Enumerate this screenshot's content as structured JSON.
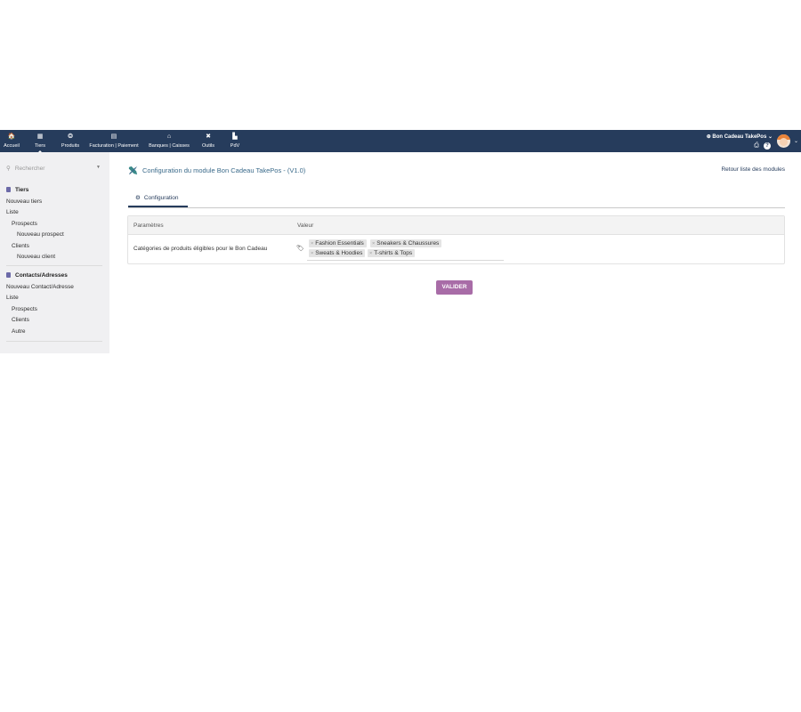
{
  "nav": {
    "items": [
      {
        "label": "Accueil",
        "icon": "home-icon",
        "glyph": "🏠"
      },
      {
        "label": "Tiers",
        "icon": "building-icon",
        "glyph": "▦",
        "active": true
      },
      {
        "label": "Produits",
        "icon": "cube-icon",
        "glyph": "❂"
      },
      {
        "label": "Facturation | Paiement",
        "icon": "file-icon",
        "glyph": "▤"
      },
      {
        "label": "Banques | Caisses",
        "icon": "bank-icon",
        "glyph": "⌂"
      },
      {
        "label": "Outils",
        "icon": "tools-icon",
        "glyph": "✖"
      },
      {
        "label": "PdV",
        "icon": "cash-register-icon",
        "glyph": "▙"
      }
    ],
    "company": "Bon Cadeau TakePos",
    "company_caret": "⌄",
    "globe_glyph": "⊕",
    "print_glyph": "⎙",
    "help_glyph": "?"
  },
  "sidebar": {
    "search_placeholder": "Rechercher",
    "search_icon": "⚲",
    "search_caret": "▼",
    "tiers_title": "Tiers",
    "tiers_links": [
      "Nouveau tiers",
      "Liste",
      "Prospects",
      "Nouveau prospect",
      "Clients",
      "Nouveau client"
    ],
    "contacts_title": "Contacts/Adresses",
    "contacts_links": [
      "Nouveau Contact/Adresse",
      "Liste",
      "Prospects",
      "Clients",
      "Autre"
    ],
    "tiers_color": "#6c6aa8",
    "contacts_color": "#6c6aa8"
  },
  "page": {
    "title": "Configuration du module Bon Cadeau TakePos - (V1.0)",
    "back_link": "Retour liste des modules",
    "tab_label": "Configuration",
    "tab_icon_glyph": "⚙"
  },
  "table": {
    "col_params": "Paramètres",
    "col_value": "Valeur",
    "row_label": "Catégories de produits éligibles pour le Bon Cadeau",
    "tag_glyph": "🏷",
    "chips": [
      "Fashion Essentials",
      "Sneakers & Chaussures",
      "Sweats & Hoodies",
      "T-shirts & Tops"
    ],
    "chip_remove": "×"
  },
  "submit_label": "VALIDER",
  "colors": {
    "topbar": "#263c5c",
    "button": "#a86ca7",
    "title": "#3a6a8a"
  }
}
